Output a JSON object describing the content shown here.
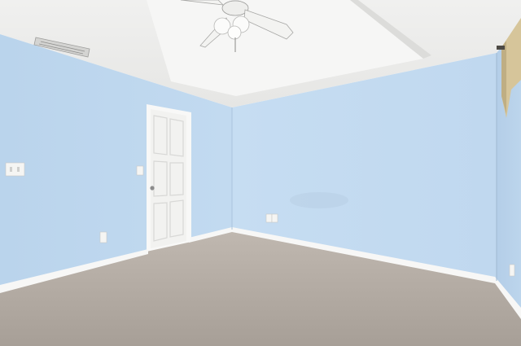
{
  "scene": {
    "colors": {
      "ceiling": "#ededec",
      "tray_ceiling": "#f3f3f2",
      "wall_left": "#bcd6ee",
      "wall_back": "#c4dcf2",
      "wall_right": "#b7d1ea",
      "carpet": "#b3aba3",
      "baseboard": "#f7f7f6",
      "door": "#f4f4f2",
      "curtain": "#d9c99f"
    },
    "objects": [
      "ceiling-fan",
      "air-vent",
      "door",
      "light-switch-plate",
      "outlet",
      "baseboard",
      "carpet",
      "curtain"
    ]
  }
}
